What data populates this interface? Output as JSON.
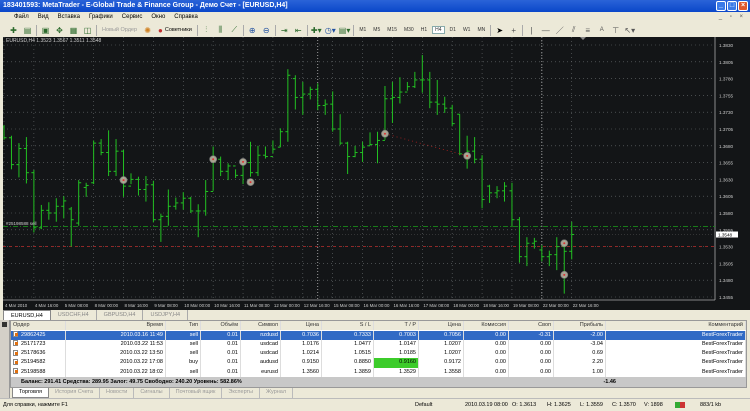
{
  "window": {
    "title": "183401593: MetaTrader - E-Global Trade & Finance Group - Демо Счет - [EURUSD,H4]"
  },
  "menu": [
    "Файл",
    "Вид",
    "Вставка",
    "Графики",
    "Сервис",
    "Окно",
    "Справка"
  ],
  "toolbar": {
    "new_order": "Новый Ордер",
    "experts": "Советники",
    "timeframes": [
      "M1",
      "M5",
      "M15",
      "M30",
      "H1",
      "H4",
      "D1",
      "W1",
      "MN"
    ],
    "active_timeframe": "H4"
  },
  "chart": {
    "header": "EURUSD,H4  1.3523 1.3567 1.3511 1.3548",
    "order_label": "#25198588 sell",
    "current_price": "1.3548",
    "colors": {
      "background": "#131517",
      "bar": "#22c022",
      "grid": "#6a6e70",
      "entry_line": "#1a8a1a",
      "tp_line": "#a02828",
      "marker": "#b8b0a0"
    }
  },
  "chart_data": {
    "type": "ohlc",
    "symbol": "EURUSD",
    "timeframe": "H4",
    "ylim": [
      1.3455,
      1.383
    ],
    "price_ticks": [
      "1.3830",
      "1.3805",
      "1.3780",
      "1.3755",
      "1.3730",
      "1.3705",
      "1.3680",
      "1.3655",
      "1.3630",
      "1.3605",
      "1.3580",
      "1.3555",
      "1.3530",
      "1.3505",
      "1.3480",
      "1.3455"
    ],
    "time_labels": [
      "4 Mar 2010",
      "4 Mar 16:00",
      "5 Mar 08:00",
      "8 Mar 00:00",
      "8 Mar 16:00",
      "9 Mar 08:00",
      "10 Mar 00:00",
      "10 Mar 16:00",
      "11 Mar 08:00",
      "12 Mar 00:00",
      "12 Mar 16:00",
      "15 Mar 08:00",
      "16 Mar 00:00",
      "16 Mar 16:00",
      "17 Mar 08:00",
      "18 Mar 00:00",
      "18 Mar 16:00",
      "19 Mar 08:00",
      "22 Mar 00:00",
      "22 Mar 16:00"
    ],
    "bars_ohlc": [
      [
        1.3708,
        1.3711,
        1.3689,
        1.3692
      ],
      [
        1.3692,
        1.3695,
        1.3645,
        1.3652
      ],
      [
        1.3652,
        1.3684,
        1.3633,
        1.3676
      ],
      [
        1.3676,
        1.3693,
        1.3624,
        1.364
      ],
      [
        1.364,
        1.3644,
        1.3551,
        1.3558
      ],
      [
        1.3558,
        1.3592,
        1.3556,
        1.3584
      ],
      [
        1.3584,
        1.3596,
        1.357,
        1.358
      ],
      [
        1.358,
        1.3602,
        1.3567,
        1.359
      ],
      [
        1.359,
        1.3605,
        1.3572,
        1.3598
      ],
      [
        1.3586,
        1.3589,
        1.353,
        1.357
      ],
      [
        1.3565,
        1.3629,
        1.3561,
        1.3625
      ],
      [
        1.3618,
        1.3625,
        1.3604,
        1.3621
      ],
      [
        1.3625,
        1.3688,
        1.3623,
        1.3684
      ],
      [
        1.3684,
        1.369,
        1.3666,
        1.367
      ],
      [
        1.367,
        1.3703,
        1.3635,
        1.3642
      ],
      [
        1.3642,
        1.369,
        1.3635,
        1.3672
      ],
      [
        1.3672,
        1.3674,
        1.3604,
        1.362
      ],
      [
        1.362,
        1.3639,
        1.3623,
        1.363
      ],
      [
        1.363,
        1.3634,
        1.3606,
        1.3615
      ],
      [
        1.3615,
        1.3635,
        1.3597,
        1.3622
      ],
      [
        1.3622,
        1.3628,
        1.3566,
        1.357
      ],
      [
        1.357,
        1.3579,
        1.3537,
        1.3575
      ],
      [
        1.3575,
        1.3615,
        1.3561,
        1.359
      ],
      [
        1.359,
        1.3603,
        1.3585,
        1.3595
      ],
      [
        1.3595,
        1.3611,
        1.3585,
        1.3602
      ],
      [
        1.3602,
        1.3604,
        1.358,
        1.3583
      ],
      [
        1.3583,
        1.3593,
        1.3544,
        1.3583
      ],
      [
        1.3583,
        1.3629,
        1.3576,
        1.3612
      ],
      [
        1.3612,
        1.3679,
        1.3613,
        1.366
      ],
      [
        1.366,
        1.3664,
        1.3635,
        1.3642
      ],
      [
        1.3642,
        1.3654,
        1.3629,
        1.365
      ],
      [
        1.365,
        1.3645,
        1.3632,
        1.3636
      ],
      [
        1.3636,
        1.366,
        1.3623,
        1.3655
      ],
      [
        1.3655,
        1.3686,
        1.3634,
        1.364
      ],
      [
        1.364,
        1.368,
        1.3635,
        1.3666
      ],
      [
        1.3666,
        1.3679,
        1.3661,
        1.3664
      ],
      [
        1.3664,
        1.3688,
        1.3669,
        1.3675
      ],
      [
        1.3678,
        1.3706,
        1.3678,
        1.3701
      ],
      [
        1.3701,
        1.3794,
        1.3686,
        1.3785
      ],
      [
        1.378,
        1.3785,
        1.3734,
        1.3752
      ],
      [
        1.3752,
        1.3775,
        1.3726,
        1.3757
      ],
      [
        1.3757,
        1.3768,
        1.3749,
        1.3764
      ],
      [
        1.3764,
        1.3773,
        1.3733,
        1.374
      ],
      [
        1.374,
        1.3749,
        1.3726,
        1.3742
      ],
      [
        1.3742,
        1.3761,
        1.3701,
        1.3705
      ],
      [
        1.3705,
        1.3727,
        1.3681,
        1.3684
      ],
      [
        1.3684,
        1.3686,
        1.3638,
        1.3664
      ],
      [
        1.3664,
        1.368,
        1.3663,
        1.367
      ],
      [
        1.367,
        1.3686,
        1.3656,
        1.3678
      ],
      [
        1.368,
        1.37,
        1.368,
        1.3682
      ],
      [
        1.3682,
        1.3701,
        1.3654,
        1.3688
      ],
      [
        1.3688,
        1.3769,
        1.3689,
        1.375
      ],
      [
        1.375,
        1.3775,
        1.3714,
        1.3752
      ],
      [
        1.3752,
        1.3782,
        1.3743,
        1.376
      ],
      [
        1.376,
        1.3775,
        1.3762,
        1.3768
      ],
      [
        1.3768,
        1.379,
        1.3766,
        1.3778
      ],
      [
        1.3778,
        1.3815,
        1.3759,
        1.3778
      ],
      [
        1.3778,
        1.379,
        1.3736,
        1.3745
      ],
      [
        1.3745,
        1.3778,
        1.3726,
        1.3742
      ],
      [
        1.3742,
        1.3753,
        1.3729,
        1.3736
      ],
      [
        1.3736,
        1.3741,
        1.3709,
        1.3713
      ],
      [
        1.3727,
        1.3727,
        1.3666,
        1.3668
      ],
      [
        1.3668,
        1.3695,
        1.3646,
        1.3672
      ],
      [
        1.3672,
        1.3693,
        1.3654,
        1.366
      ],
      [
        1.366,
        1.3666,
        1.3587,
        1.36
      ],
      [
        1.362,
        1.3622,
        1.3595,
        1.361
      ],
      [
        1.361,
        1.362,
        1.3602,
        1.3613
      ],
      [
        1.3613,
        1.3626,
        1.3597,
        1.362
      ],
      [
        1.3613,
        1.3625,
        1.3559,
        1.357
      ],
      [
        1.357,
        1.3574,
        1.3506,
        1.3515
      ],
      [
        1.3515,
        1.3544,
        1.3501,
        1.3535
      ],
      [
        1.3535,
        1.3543,
        1.3527,
        1.3538
      ],
      [
        1.3525,
        1.3532,
        1.3508,
        1.3515
      ],
      [
        1.3515,
        1.3524,
        1.3501,
        1.3518
      ],
      [
        1.3518,
        1.3544,
        1.3495,
        1.353
      ],
      [
        1.353,
        1.3539,
        1.346,
        1.3523
      ],
      [
        1.3523,
        1.3567,
        1.3511,
        1.3548
      ]
    ],
    "period_separators_bar_index": [
      42,
      72
    ],
    "levels": [
      {
        "price": 1.356,
        "style": "dash-dot",
        "color": "#1a8a1a"
      },
      {
        "price": 1.353,
        "style": "dashed",
        "color": "#a02828"
      }
    ],
    "trade_markers": [
      {
        "bar": 16,
        "price": 1.3629
      },
      {
        "bar": 28,
        "price": 1.366
      },
      {
        "bar": 32,
        "price": 1.3656
      },
      {
        "bar": 33,
        "price": 1.3626
      },
      {
        "bar": 51,
        "price": 1.3698
      },
      {
        "bar": 62,
        "price": 1.3665
      },
      {
        "bar": 75,
        "price": 1.3535
      },
      {
        "bar": 75,
        "price": 1.3488
      }
    ],
    "trade_link": {
      "from": {
        "bar": 51,
        "price": 1.3698
      },
      "to": {
        "bar": 62,
        "price": 1.3665
      }
    }
  },
  "chart_tabs": [
    {
      "label": "EURUSD,H4",
      "active": true
    },
    {
      "label": "USDCHF,H4"
    },
    {
      "label": "GBPUSD,H4"
    },
    {
      "label": "USDJPY,H4"
    }
  ],
  "terminal": {
    "columns": [
      "Ордер",
      "Время",
      "Тип",
      "Объём",
      "Символ",
      "Цена",
      "S / L",
      "T / P",
      "Цена",
      "Комиссия",
      "Своп",
      "Прибыль",
      "Комментарий"
    ],
    "rows": [
      {
        "cells": [
          "29862425",
          "2010.03.16 11:49",
          "sell",
          "0.01",
          "nzdusd",
          "0.7036",
          "0.7333",
          "0.7003",
          "0.7056",
          "0.00",
          "-0.31",
          "-2.00",
          "BestForexTrader"
        ],
        "selected": true
      },
      {
        "cells": [
          "25171723",
          "2010.03.22 11:53",
          "sell",
          "0.01",
          "usdcad",
          "1.0176",
          "1.0477",
          "1.0147",
          "1.0207",
          "0.00",
          "0.00",
          "-3.04",
          "BestForexTrader"
        ]
      },
      {
        "cells": [
          "25178636",
          "2010.03.22 13:50",
          "sell",
          "0.01",
          "usdcad",
          "1.0214",
          "1.0515",
          "1.0185",
          "1.0207",
          "0.00",
          "0.00",
          "0.69",
          "BestForexTrader"
        ]
      },
      {
        "cells": [
          "25194582",
          "2010.03.22 17:08",
          "buy",
          "0.01",
          "audusd",
          "0.9150",
          "0.8850",
          "0.9160",
          "0.9172",
          "0.00",
          "0.00",
          "2.20",
          "BestForexTrader"
        ],
        "highlight_col": 7
      },
      {
        "cells": [
          "25198588",
          "2010.03.22 18:02",
          "sell",
          "0.01",
          "eurusd",
          "1.3560",
          "1.3859",
          "1.3529",
          "1.3558",
          "0.00",
          "0.00",
          "1.00",
          "BestForexTrader"
        ]
      }
    ],
    "balance": "Баланс: 291.41  Средства: 289.95  Залог: 49.75  Свободно: 240.20  Уровень: 582.86%",
    "total_profit": "-1.46",
    "tabs": [
      "Торговля",
      "История Счета",
      "Новости",
      "Сигналы",
      "Почтовый ящик",
      "Эксперты",
      "Журнал"
    ]
  },
  "status": {
    "help": "Для справки, нажмите F1",
    "profile": "Default",
    "time": "2010.03.19 08:00",
    "open": "O: 1.3613",
    "high": "H: 1.3625",
    "low": "L: 1.3559",
    "close": "C: 1.3570",
    "volume": "V: 1898",
    "traffic": "883/1 kb"
  }
}
